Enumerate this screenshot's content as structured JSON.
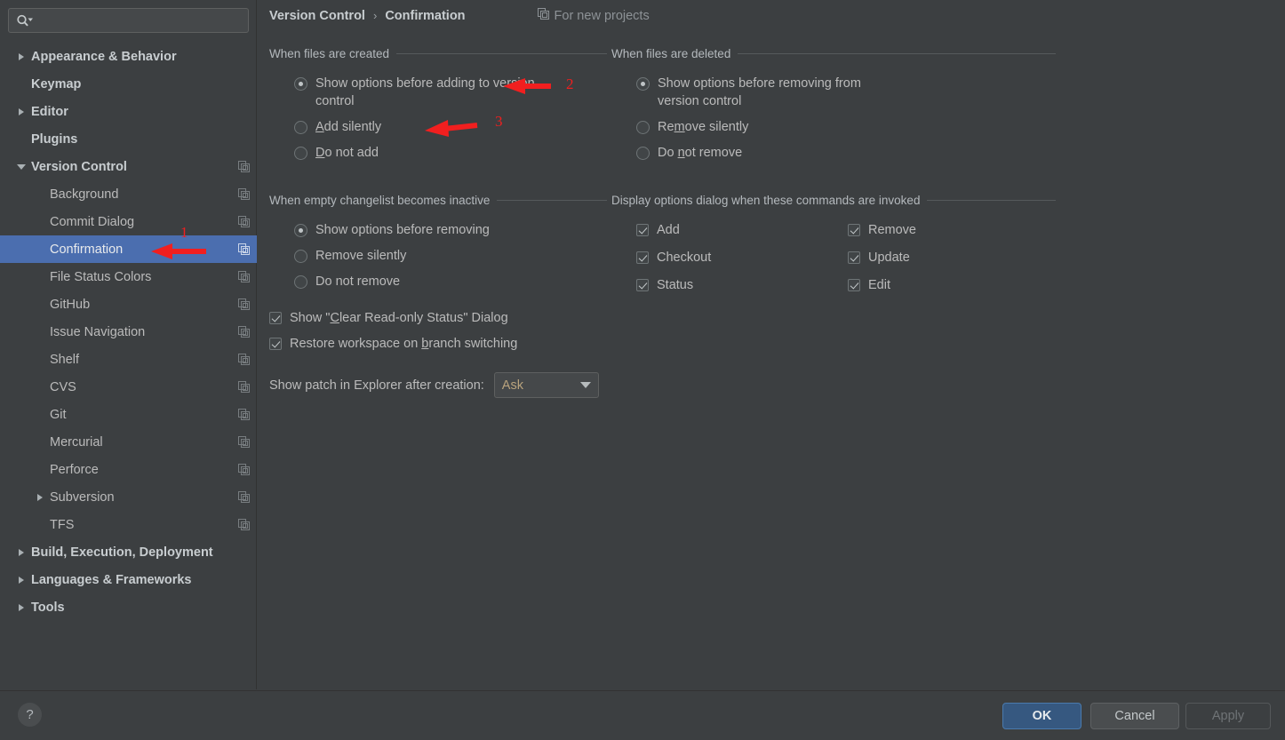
{
  "window": {
    "theme_bg": "#3c3f41",
    "accent": "#4b6eaf",
    "annotation_color": "#f11f1f"
  },
  "sidebar": {
    "search": {
      "placeholder": "",
      "value": "",
      "icon": "search-icon"
    },
    "items": [
      {
        "label": "Appearance & Behavior",
        "indent": 0,
        "twisty": "collapsed",
        "bold": true,
        "copy": false,
        "selected": false
      },
      {
        "label": "Keymap",
        "indent": 0,
        "twisty": "none",
        "bold": true,
        "copy": false,
        "selected": false
      },
      {
        "label": "Editor",
        "indent": 0,
        "twisty": "collapsed",
        "bold": true,
        "copy": false,
        "selected": false
      },
      {
        "label": "Plugins",
        "indent": 0,
        "twisty": "none",
        "bold": true,
        "copy": false,
        "selected": false
      },
      {
        "label": "Version Control",
        "indent": 0,
        "twisty": "expanded",
        "bold": true,
        "copy": true,
        "selected": false
      },
      {
        "label": "Background",
        "indent": 1,
        "twisty": "none",
        "bold": false,
        "copy": true,
        "selected": false
      },
      {
        "label": "Commit Dialog",
        "indent": 1,
        "twisty": "none",
        "bold": false,
        "copy": true,
        "selected": false
      },
      {
        "label": "Confirmation",
        "indent": 1,
        "twisty": "none",
        "bold": false,
        "copy": true,
        "selected": true
      },
      {
        "label": "File Status Colors",
        "indent": 1,
        "twisty": "none",
        "bold": false,
        "copy": true,
        "selected": false
      },
      {
        "label": "GitHub",
        "indent": 1,
        "twisty": "none",
        "bold": false,
        "copy": true,
        "selected": false
      },
      {
        "label": "Issue Navigation",
        "indent": 1,
        "twisty": "none",
        "bold": false,
        "copy": true,
        "selected": false
      },
      {
        "label": "Shelf",
        "indent": 1,
        "twisty": "none",
        "bold": false,
        "copy": true,
        "selected": false
      },
      {
        "label": "CVS",
        "indent": 1,
        "twisty": "none",
        "bold": false,
        "copy": true,
        "selected": false
      },
      {
        "label": "Git",
        "indent": 1,
        "twisty": "none",
        "bold": false,
        "copy": true,
        "selected": false
      },
      {
        "label": "Mercurial",
        "indent": 1,
        "twisty": "none",
        "bold": false,
        "copy": true,
        "selected": false
      },
      {
        "label": "Perforce",
        "indent": 1,
        "twisty": "none",
        "bold": false,
        "copy": true,
        "selected": false
      },
      {
        "label": "Subversion",
        "indent": 1,
        "twisty": "collapsed",
        "bold": false,
        "copy": true,
        "selected": false
      },
      {
        "label": "TFS",
        "indent": 1,
        "twisty": "none",
        "bold": false,
        "copy": true,
        "selected": false
      },
      {
        "label": "Build, Execution, Deployment",
        "indent": 0,
        "twisty": "collapsed",
        "bold": true,
        "copy": false,
        "selected": false
      },
      {
        "label": "Languages & Frameworks",
        "indent": 0,
        "twisty": "collapsed",
        "bold": true,
        "copy": false,
        "selected": false
      },
      {
        "label": "Tools",
        "indent": 0,
        "twisty": "collapsed",
        "bold": true,
        "copy": false,
        "selected": false
      }
    ]
  },
  "breadcrumb": {
    "parent": "Version Control",
    "separator": "›",
    "current": "Confirmation",
    "scope_label": "For new projects",
    "scope_icon": "copy-icon"
  },
  "groups": {
    "files_created": {
      "title": "When files are created",
      "options": [
        {
          "label_pre": "Show options before adding to version control",
          "mnemonic": "",
          "label_post": "",
          "selected": true
        },
        {
          "label_pre": "",
          "mnemonic": "A",
          "label_post": "dd silently",
          "selected": false
        },
        {
          "label_pre": "",
          "mnemonic": "D",
          "label_post": "o not add",
          "selected": false
        }
      ]
    },
    "files_deleted": {
      "title": "When files are deleted",
      "options": [
        {
          "label_pre": "Show options before removing from version control",
          "mnemonic": "",
          "label_post": "",
          "selected": true
        },
        {
          "label_pre": "Re",
          "mnemonic": "m",
          "label_post": "ove silently",
          "selected": false
        },
        {
          "label_pre": "Do ",
          "mnemonic": "n",
          "label_post": "ot remove",
          "selected": false
        }
      ]
    },
    "empty_changelist": {
      "title": "When empty changelist becomes inactive",
      "options": [
        {
          "label_pre": "Show options before removing",
          "mnemonic": "",
          "label_post": "",
          "selected": true
        },
        {
          "label_pre": "Remove silently",
          "mnemonic": "",
          "label_post": "",
          "selected": false
        },
        {
          "label_pre": "Do not remove",
          "mnemonic": "",
          "label_post": "",
          "selected": false
        }
      ]
    },
    "display_options": {
      "title": "Display options dialog when these commands are invoked",
      "checkboxes_left": [
        {
          "label": "Add",
          "checked": true
        },
        {
          "label": "Checkout",
          "checked": true
        },
        {
          "label": "Status",
          "checked": true
        }
      ],
      "checkboxes_right": [
        {
          "label": "Remove",
          "checked": true
        },
        {
          "label": "Update",
          "checked": true
        },
        {
          "label": "Edit",
          "checked": true
        }
      ]
    }
  },
  "extra": {
    "clear_readonly": {
      "pre": "Show \"",
      "mnemonic": "C",
      "post": "lear Read-only Status\" Dialog",
      "checked": true
    },
    "restore_workspace": {
      "pre": "Restore workspace on ",
      "mnemonic": "b",
      "post": "ranch switching",
      "checked": true
    },
    "patch_label": "Show patch in Explorer after creation:",
    "patch_value": "Ask"
  },
  "footer": {
    "help": "?",
    "ok": "OK",
    "cancel": "Cancel",
    "apply": "Apply"
  },
  "annotations": [
    {
      "number": "1"
    },
    {
      "number": "2"
    },
    {
      "number": "3"
    }
  ]
}
